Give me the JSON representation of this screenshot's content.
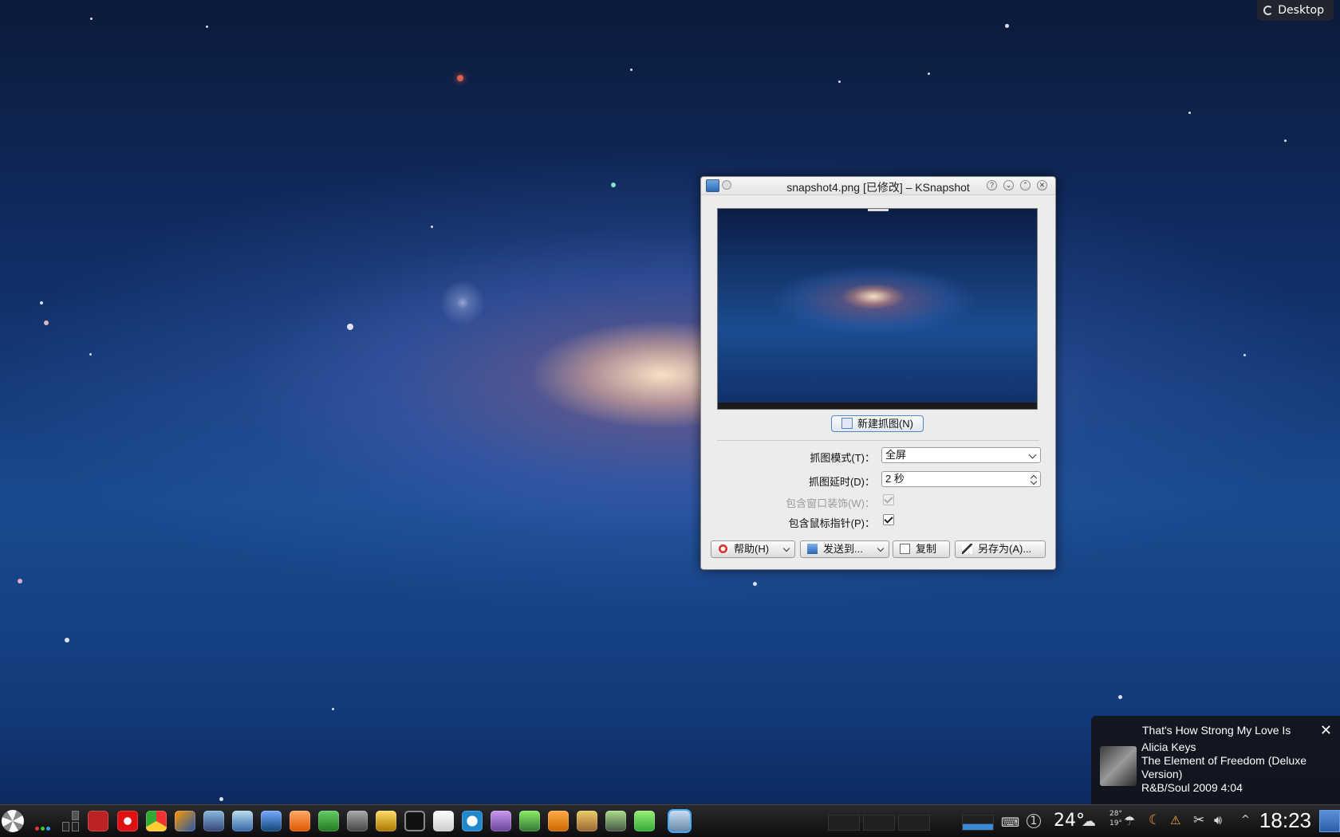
{
  "desktop": {
    "label": "Desktop"
  },
  "window": {
    "title": "snapshot4.png [已修改] – KSnapshot",
    "new_snapshot_label": "新建抓图(N)",
    "mode_label": "抓图模式(T)：",
    "mode_value": "全屏",
    "delay_label": "抓图延时(D)：",
    "delay_value": "2 秒",
    "window_deco_label": "包含窗口装饰(W)：",
    "window_deco_checked": true,
    "window_deco_enabled": false,
    "pointer_label": "包含鼠标指针(P)：",
    "pointer_checked": true,
    "buttons": {
      "help": "帮助(H)",
      "send_to": "发送到...",
      "copy": "复制",
      "save_as": "另存为(A)..."
    }
  },
  "notification": {
    "title": "That's How Strong My Love Is",
    "artist": "Alicia Keys",
    "album_line1": "The Element of Freedom (Deluxe",
    "album_line2": "Version)",
    "meta": "R&B/Soul 2009 4:04"
  },
  "taskbar": {
    "temperature": "24°",
    "hi": "28°",
    "lo": "19°",
    "clock": "18:23",
    "badge": "1"
  }
}
